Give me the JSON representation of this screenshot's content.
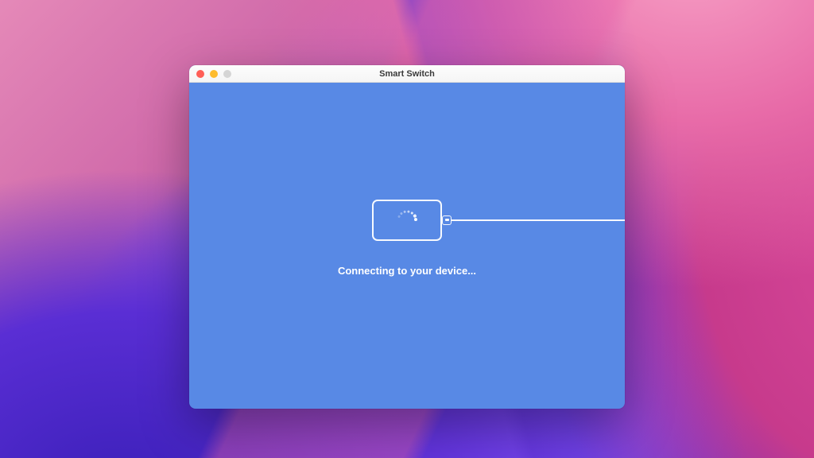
{
  "window": {
    "title": "Smart Switch"
  },
  "main": {
    "status": "Connecting to your device..."
  },
  "colors": {
    "app_background": "#5889e5",
    "accent": "#ffffff"
  }
}
